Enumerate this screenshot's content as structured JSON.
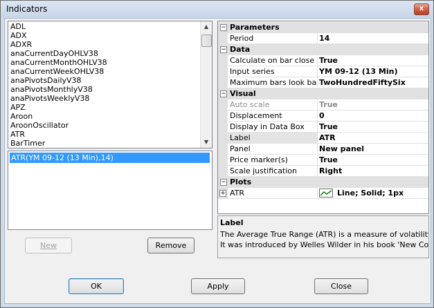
{
  "window": {
    "title": "Indicators",
    "close_glyph": "x"
  },
  "indicators": [
    "ADL",
    "ADX",
    "ADXR",
    "anaCurrentDayOHLV38",
    "anaCurrentMonthOHLV38",
    "anaCurrentWeekOHLV38",
    "anaPivotsDailyV38",
    "anaPivotsMonthlyV38",
    "anaPivotsWeeklyV38",
    "APZ",
    "Aroon",
    "AroonOscillator",
    "ATR",
    "BarTimer"
  ],
  "applied": [
    "ATR(YM 09-12 (13 Min),14)"
  ],
  "buttons": {
    "new": "New",
    "remove": "Remove",
    "ok": "OK",
    "apply": "Apply",
    "close": "Close"
  },
  "properties": {
    "parameters": {
      "label": "Parameters",
      "toggle": "−",
      "rows": [
        {
          "name": "Period",
          "value": "14"
        }
      ]
    },
    "data": {
      "label": "Data",
      "toggle": "−",
      "rows": [
        {
          "name": "Calculate on bar close",
          "value": "True"
        },
        {
          "name": "Input series",
          "value": "YM 09-12 (13 Min)"
        },
        {
          "name": "Maximum bars look back",
          "value": "TwoHundredFiftySix"
        }
      ]
    },
    "visual": {
      "label": "Visual",
      "toggle": "−",
      "rows": [
        {
          "name": "Auto scale",
          "value": "True"
        },
        {
          "name": "Displacement",
          "value": "0"
        },
        {
          "name": "Display in Data Box",
          "value": "True"
        },
        {
          "name": "Label",
          "value": "ATR"
        },
        {
          "name": "Panel",
          "value": "New panel"
        },
        {
          "name": "Price marker(s)",
          "value": "True"
        },
        {
          "name": "Scale justification",
          "value": "Right"
        }
      ]
    },
    "plots": {
      "label": "Plots",
      "toggle": "−",
      "rows": [
        {
          "name": "ATR",
          "value": "Line; Solid; 1px",
          "toggle": "+"
        }
      ]
    }
  },
  "description": {
    "title": "Label",
    "text1": "The Average True Range (ATR) is a measure of volatility.",
    "text2": "It was introduced by Welles Wilder in his book 'New Conc…"
  },
  "colors": {
    "selection": "#3399ff",
    "plot_line": "#008000"
  }
}
